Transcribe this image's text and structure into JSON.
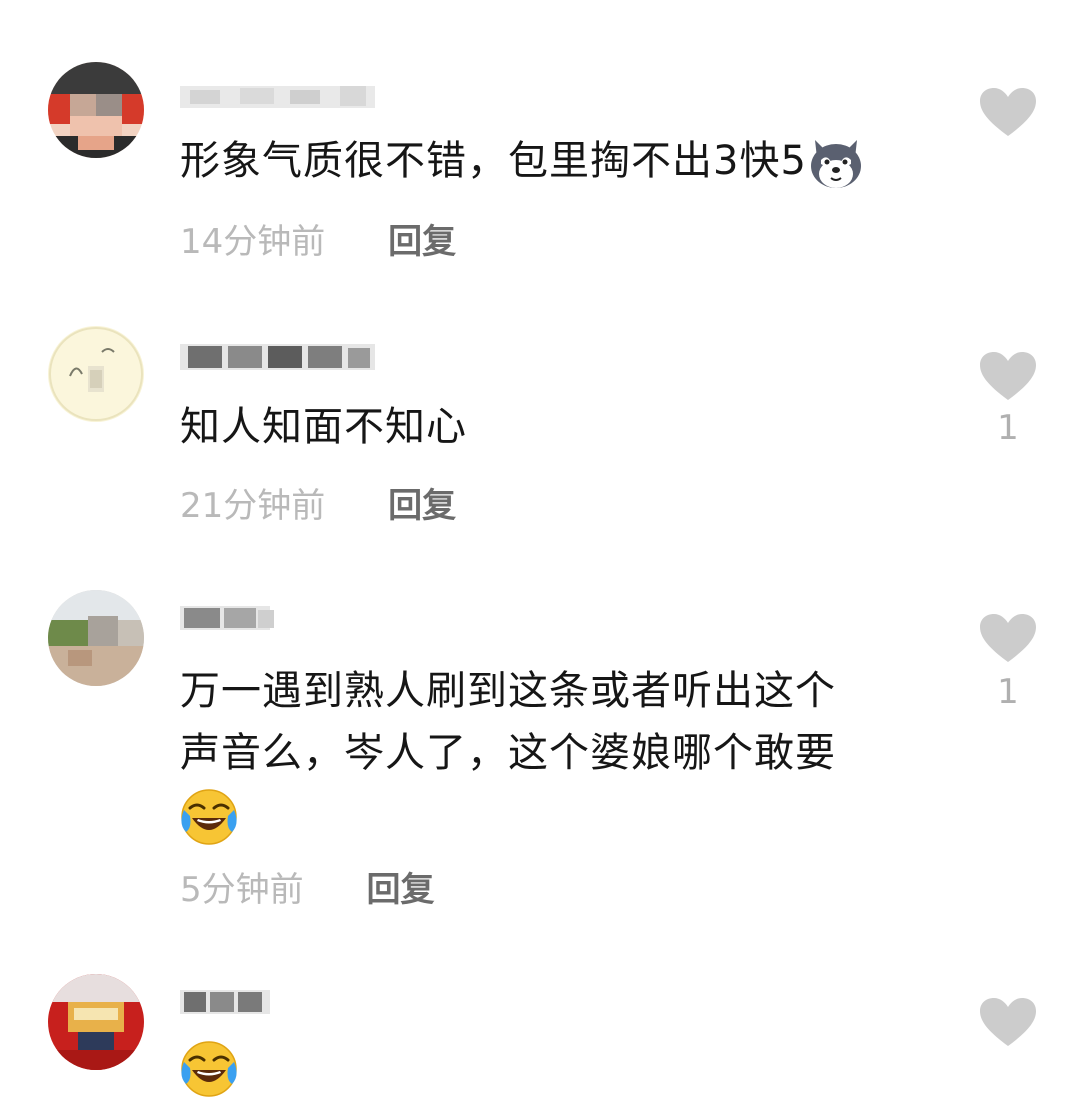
{
  "colors": {
    "time_text": "#b9b9b9",
    "reply_text": "#6b6b6b",
    "like_heart": "#cccccc",
    "comment_text": "#161616"
  },
  "comments": [
    {
      "username": "",
      "avatar_icon": "blurred-avatar-icon",
      "text": "形象气质很不错，包里掏不出3快5",
      "emoji_icon": "husky-dog-emoji-icon",
      "time": "14分钟前",
      "reply_label": "回复",
      "like_icon": "heart-icon",
      "like_count": ""
    },
    {
      "username": "",
      "avatar_icon": "blurred-avatar-icon",
      "text": "知人知面不知心",
      "time": "21分钟前",
      "reply_label": "回复",
      "like_icon": "heart-icon",
      "like_count": "1"
    },
    {
      "username": "",
      "avatar_icon": "blurred-avatar-icon",
      "text_line1": "万一遇到熟人刷到这条或者听出这个",
      "text_line2": "声音么，岑人了，这个婆娘哪个敢要",
      "emoji_icon": "laughing-crying-emoji-icon",
      "time": "5分钟前",
      "reply_label": "回复",
      "like_icon": "heart-icon",
      "like_count": "1"
    },
    {
      "username": "",
      "avatar_icon": "blurred-avatar-icon",
      "emoji_icon": "laughing-crying-emoji-icon",
      "like_icon": "heart-icon",
      "like_count": ""
    }
  ]
}
